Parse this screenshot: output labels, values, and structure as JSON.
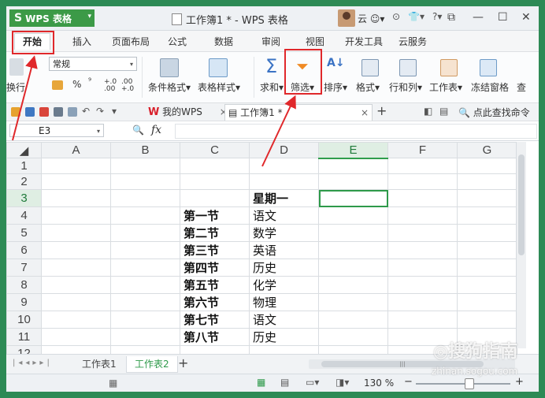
{
  "titlebar": {
    "app_name": "WPS 表格",
    "document_title": "工作簿1 * - WPS 表格",
    "user_name": "云",
    "icons": [
      "user-avatar",
      "status-icon",
      "skin-icon",
      "help-icon"
    ],
    "window_controls": [
      "minimize-icon",
      "restore-icon",
      "close-icon"
    ]
  },
  "menu": {
    "tabs": [
      "开始",
      "插入",
      "页面布局",
      "公式",
      "数据",
      "审阅",
      "视图",
      "开发工具",
      "云服务"
    ],
    "active_tab": "开始"
  },
  "ribbon": {
    "number_format": "常规",
    "wrap_label": "换行",
    "percent": "%",
    "comma": "⁹",
    "conditional_format": "条件格式",
    "table_style": "表格样式",
    "sum": "求和",
    "filter": "筛选",
    "sort": "排序",
    "format": "格式",
    "row_col": "行和列",
    "worksheet": "工作表",
    "freeze": "冻结窗格",
    "find": "查"
  },
  "quickbar": {
    "my_wps_tab": "我的WPS",
    "doc_tab": "工作簿1 *",
    "search_placeholder": "点此查找命令"
  },
  "formula_bar": {
    "name_box": "E3",
    "fx_label": "fx",
    "value": ""
  },
  "grid": {
    "columns": [
      "A",
      "B",
      "C",
      "D",
      "E",
      "F",
      "G"
    ],
    "rows": [
      "1",
      "2",
      "3",
      "4",
      "5",
      "6",
      "7",
      "8",
      "9",
      "10",
      "11",
      "12"
    ],
    "cells": {
      "D3": "星期一",
      "C4": "第一节",
      "D4": "语文",
      "C5": "第二节",
      "D5": "数学",
      "C6": "第三节",
      "D6": "英语",
      "C7": "第四节",
      "D7": "历史",
      "C8": "第五节",
      "D8": "化学",
      "C9": "第六节",
      "D9": "物理",
      "C10": "第七节",
      "D10": "语文",
      "C11": "第八节",
      "D11": "历史"
    },
    "selected_cell": "E3"
  },
  "sheets": {
    "tabs": [
      "工作表1",
      "工作表2"
    ],
    "active": "工作表2"
  },
  "status": {
    "zoom": "130 %"
  },
  "watermark": {
    "brand": "搜狗指南",
    "url": "zhinan.sogou.com"
  },
  "colors": {
    "accent_green": "#3c9a47",
    "annotation_red": "#e0282b",
    "selection_green": "#2e9a4a"
  }
}
